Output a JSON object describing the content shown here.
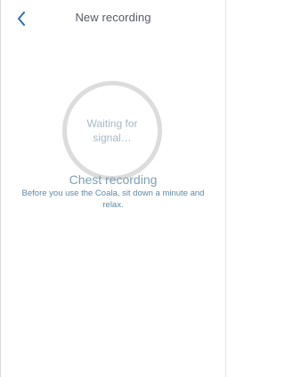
{
  "header": {
    "back_icon": "chevron-left-icon",
    "title": "New recording"
  },
  "status": {
    "ring_text": "Waiting for signal…"
  },
  "recording": {
    "title": "Chest recording",
    "instructions": "Before you use the Coala, sit down a minute and relax."
  },
  "colors": {
    "accent": "#2f6fb0",
    "ring": "#dcdcdc",
    "muted_text": "#a9b8c3",
    "info_text": "#5f88a6"
  }
}
